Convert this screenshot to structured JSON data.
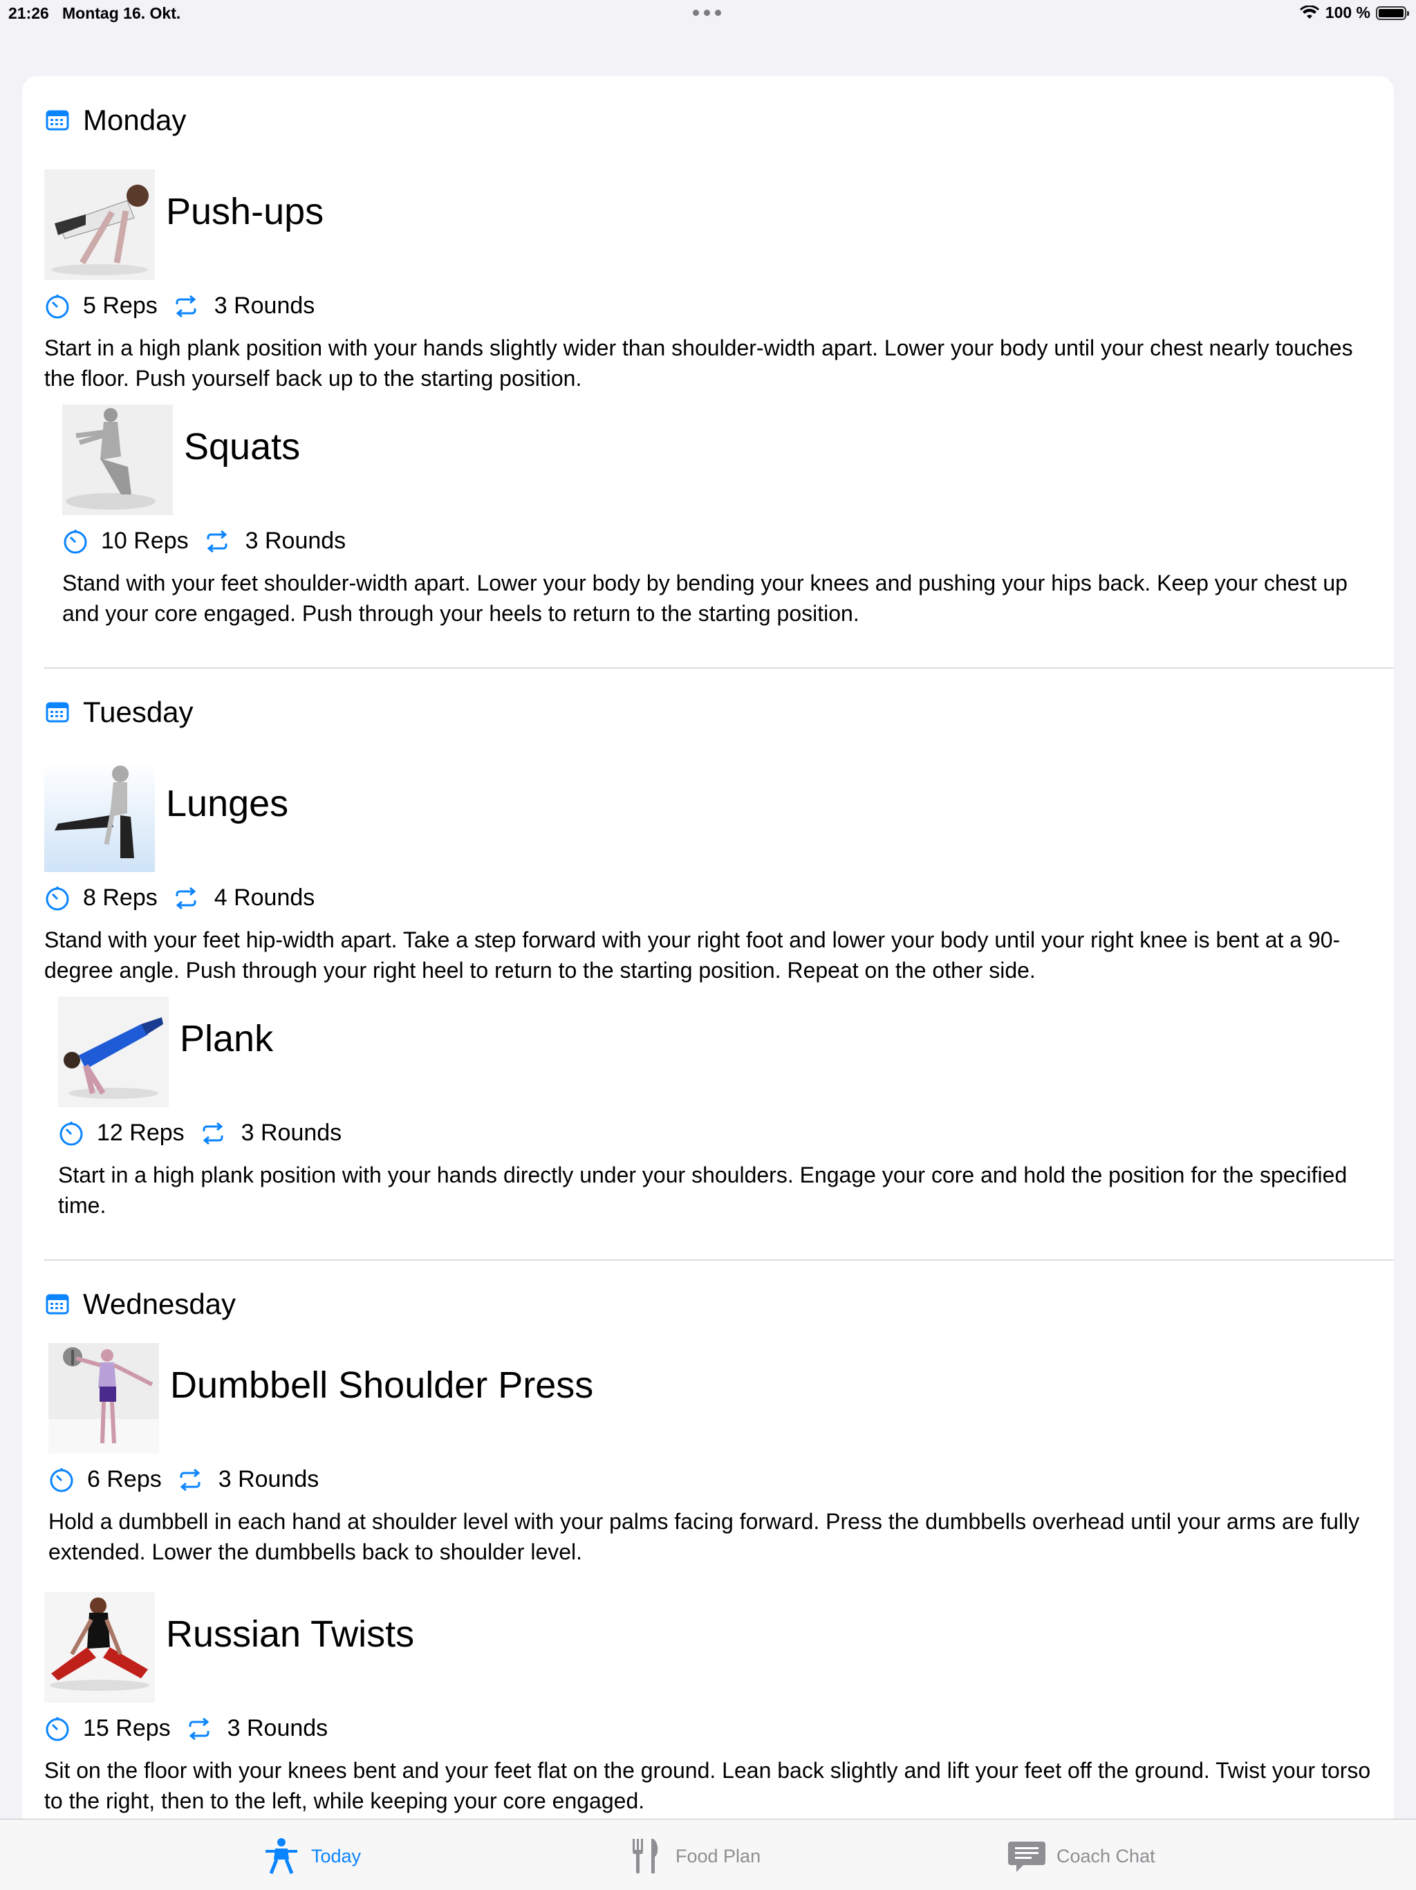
{
  "status_bar": {
    "time": "21:26",
    "date": "Montag 16. Okt.",
    "battery": "100 %",
    "battery_level": 1.0
  },
  "days": [
    {
      "label": "Monday",
      "exercises": [
        {
          "name": "Push-ups",
          "reps": "5 Reps",
          "rounds": "3 Rounds",
          "description": "Start in a high plank position with your hands slightly wider than shoulder-width apart. Lower your body until your chest nearly touches the floor. Push yourself back up to the starting position."
        },
        {
          "name": "Squats",
          "reps": "10 Reps",
          "rounds": "3 Rounds",
          "description": "Stand with your feet shoulder-width apart. Lower your body by bending your knees and pushing your hips back. Keep your chest up and your core engaged. Push through your heels to return to the starting position."
        }
      ]
    },
    {
      "label": "Tuesday",
      "exercises": [
        {
          "name": "Lunges",
          "reps": "8 Reps",
          "rounds": "4 Rounds",
          "description": "Stand with your feet hip-width apart. Take a step forward with your right foot and lower your body until your right knee is bent at a 90-degree angle. Push through your right heel to return to the starting position. Repeat on the other side."
        },
        {
          "name": "Plank",
          "reps": "12 Reps",
          "rounds": "3 Rounds",
          "description": "Start in a high plank position with your hands directly under your shoulders. Engage your core and hold the position for the specified time."
        }
      ]
    },
    {
      "label": "Wednesday",
      "exercises": [
        {
          "name": "Dumbbell Shoulder Press",
          "reps": "6 Reps",
          "rounds": "3 Rounds",
          "description": "Hold a dumbbell in each hand at shoulder level with your palms facing forward. Press the dumbbells overhead until your arms are fully extended. Lower the dumbbells back to shoulder level."
        },
        {
          "name": "Russian Twists",
          "reps": "15 Reps",
          "rounds": "3 Rounds",
          "description": "Sit on the floor with your knees bent and your feet flat on the ground. Lean back slightly and lift your feet off the ground. Twist your torso to the right, then to the left, while keeping your core engaged."
        }
      ]
    }
  ],
  "tabs": [
    {
      "label": "Today",
      "icon": "figure-run-icon",
      "active": true
    },
    {
      "label": "Food Plan",
      "icon": "fork-knife-icon",
      "active": false
    },
    {
      "label": "Coach Chat",
      "icon": "chat-bubble-icon",
      "active": false
    }
  ],
  "colors": {
    "accent": "#0a84ff",
    "inactive": "#8e8e93",
    "background": "#f2f2f7"
  }
}
